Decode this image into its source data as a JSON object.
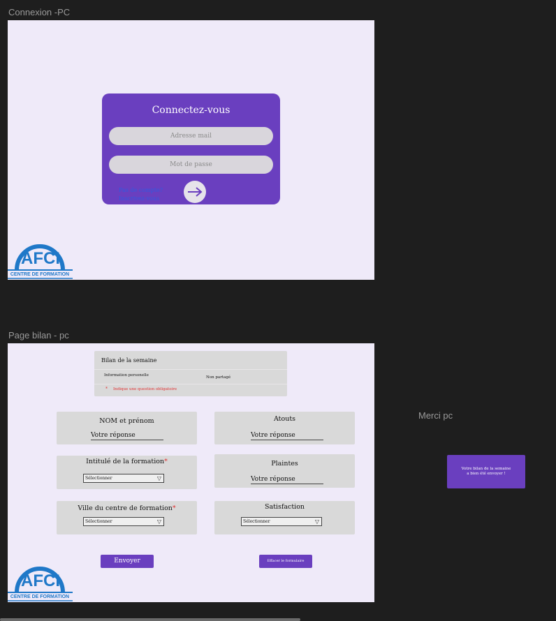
{
  "frames": {
    "login_title": "Connexion -PC",
    "bilan_title": "Page bilan - pc",
    "merci_title": "Merci pc"
  },
  "login": {
    "heading": "Connectez-vous",
    "email_placeholder": "Adresse mail",
    "password_placeholder": "Mot de passe",
    "link_line1": "Pas de compte?",
    "link_line2": "Inscrivez-vous"
  },
  "logo": {
    "text": "AFCI",
    "subtitle": "CENTRE DE FORMATION"
  },
  "bilan": {
    "header_title": "Bilan de la semaine",
    "personal_info": "Information personelle",
    "not_shared": "Non partagé",
    "required_star": "*",
    "required_note": "Indique une question obligatoire",
    "questions": {
      "name_label": "NOM et prénom",
      "name_answer": "Votre réponse",
      "atouts_label": "Atouts",
      "atouts_answer": "Votre réponse",
      "formation_label": "Intitulé de la formation",
      "formation_select": "Sélectionner",
      "plaintes_label": "Plaintes",
      "plaintes_answer": "Votre réponse",
      "ville_label": "Ville du centre de  formation",
      "ville_select": "Sélectionner",
      "satisfaction_label": "Satisfaction",
      "satisfaction_select": "Sélectionner"
    },
    "submit_label": "Envoyer",
    "clear_label": "Effacer le formulaire"
  },
  "merci": {
    "line1": "Votre bilan de la semaine",
    "line2": "a bien été envoyer !"
  },
  "colors": {
    "accent": "#6a3fbf",
    "frame_bg": "#efeaf9",
    "card_bg": "#d9d9d9",
    "canvas_bg": "#1e1e1e",
    "required": "#e03030",
    "link": "#2f5be0"
  }
}
